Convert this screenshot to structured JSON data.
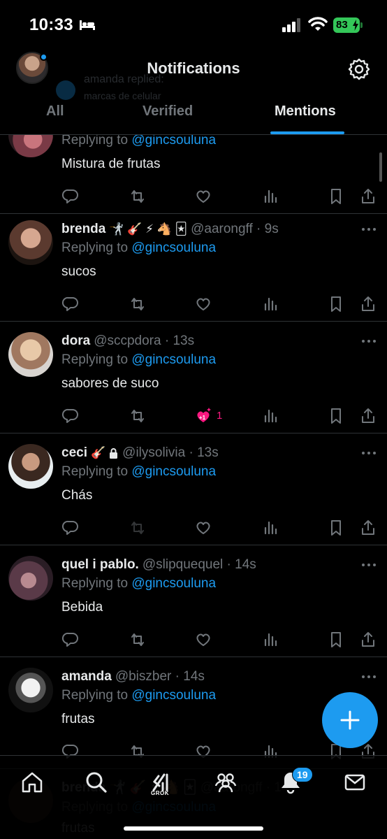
{
  "status_bar": {
    "time": "10:33",
    "battery": "83"
  },
  "header": {
    "title": "Notifications",
    "ghost_toast": {
      "line1": "amanda replied:",
      "line2": "marcas de celular"
    }
  },
  "tabs": [
    {
      "label": "All"
    },
    {
      "label": "Verified"
    },
    {
      "label": "Mentions"
    }
  ],
  "tweets": [
    {
      "name": "",
      "emoji": "",
      "handle": "",
      "time": "",
      "reply_prefix": "Replying to ",
      "reply_handle": "@gincsouluna",
      "text": "Mistura de frutas",
      "like_count": ""
    },
    {
      "name": "brenda",
      "emoji": "🤺 🎸 ⚡ 🐴 🃏",
      "handle": "@aarongff",
      "time": "9s",
      "reply_prefix": "Replying to ",
      "reply_handle": "@gincsouluna",
      "text": "sucos",
      "like_count": ""
    },
    {
      "name": "dora",
      "emoji": "",
      "handle": "@sccpdora",
      "time": "13s",
      "reply_prefix": "Replying to ",
      "reply_handle": "@gincsouluna",
      "text": "sabores de suco",
      "like_count": "1"
    },
    {
      "name": "ceci",
      "emoji": "🎸",
      "handle": "@ilysolivia",
      "time": "13s",
      "reply_prefix": "Replying to ",
      "reply_handle": "@gincsouluna",
      "text": "Chás",
      "like_count": ""
    },
    {
      "name": "quel i pablo.",
      "emoji": "",
      "handle": "@slipquequel",
      "time": "14s",
      "reply_prefix": "Replying to ",
      "reply_handle": "@gincsouluna",
      "text": "Bebida",
      "like_count": ""
    },
    {
      "name": "amanda",
      "emoji": "",
      "handle": "@biszber",
      "time": "14s",
      "reply_prefix": "Replying to ",
      "reply_handle": "@gincsouluna",
      "text": "frutas",
      "like_count": ""
    }
  ],
  "ghost_tweet": {
    "name": "brenda",
    "emoji": "🤺 🎸 ⚡ 🐴 🃏",
    "meta": "@aarongff · 14s",
    "reply_prefix": "Replying to ",
    "reply_handle": "@gincsouluna",
    "text": "frutas"
  },
  "bottom_nav": {
    "grok_label": "GROK",
    "notification_badge": "19"
  },
  "colors": {
    "accent": "#1d9bf0",
    "like": "#f91880",
    "muted": "#71767b",
    "text": "#e7e9ea",
    "battery": "#34c759"
  }
}
